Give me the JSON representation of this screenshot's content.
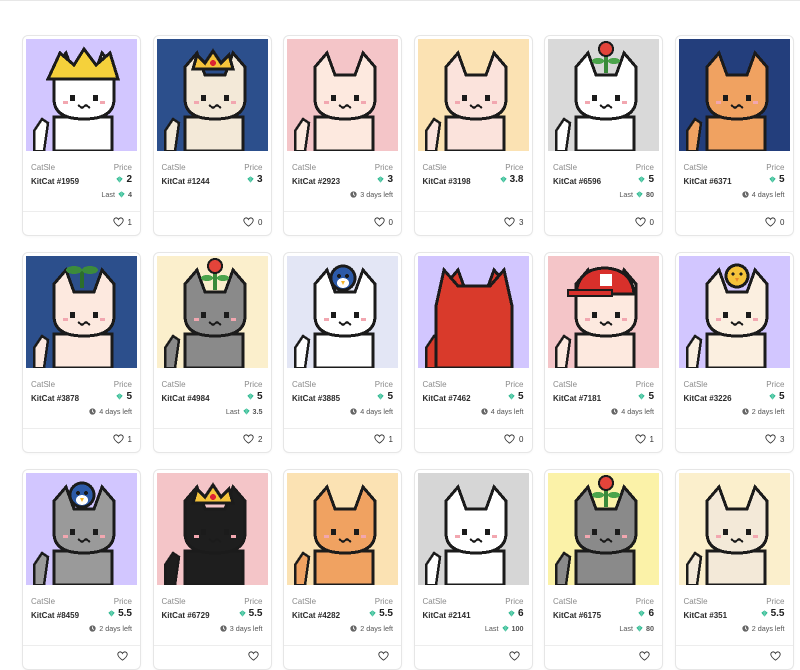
{
  "colors": {
    "gem": "#2fb991",
    "card_border": "#e6e6e6"
  },
  "cards": [
    {
      "collection": "CatSle",
      "name": "KitCat #1959",
      "price_label": "Price",
      "price": "2",
      "sub_type": "last",
      "sub_prefix": "Last",
      "sub_value": "4",
      "likes": "1",
      "bg": "#d2c6ff",
      "coat": "#ffffff",
      "hat": "yellow-hat"
    },
    {
      "collection": "CatSle",
      "name": "KitCat #1244",
      "price_label": "Price",
      "price": "3",
      "sub_type": "none",
      "sub_prefix": "",
      "sub_value": "",
      "likes": "0",
      "bg": "#2c4f8c",
      "coat": "#f3e9d8",
      "hat": "crown"
    },
    {
      "collection": "CatSle",
      "name": "KitCat #2923",
      "price_label": "Price",
      "price": "3",
      "sub_type": "time",
      "sub_prefix": "",
      "sub_value": "3 days left",
      "likes": "0",
      "bg": "#f4c5c8",
      "coat": "#fde9df",
      "hat": "none"
    },
    {
      "collection": "CatSle",
      "name": "KitCat #3198",
      "price_label": "Price",
      "price": "3.8",
      "sub_type": "none",
      "sub_prefix": "",
      "sub_value": "",
      "likes": "3",
      "bg": "#fbe2b3",
      "coat": "#fbe3dc",
      "hat": "none"
    },
    {
      "collection": "CatSle",
      "name": "KitCat #6596",
      "price_label": "Price",
      "price": "5",
      "sub_type": "last",
      "sub_prefix": "Last",
      "sub_value": "80",
      "likes": "0",
      "bg": "#d9d9d9",
      "coat": "#ffffff",
      "hat": "flower"
    },
    {
      "collection": "CatSle",
      "name": "KitCat #6371",
      "price_label": "Price",
      "price": "5",
      "sub_type": "time",
      "sub_prefix": "",
      "sub_value": "4 days left",
      "likes": "0",
      "bg": "#233e7c",
      "coat": "#f0a261",
      "hat": "none"
    },
    {
      "collection": "CatSle",
      "name": "KitCat #3878",
      "price_label": "Price",
      "price": "5",
      "sub_type": "time",
      "sub_prefix": "",
      "sub_value": "4 days left",
      "likes": "1",
      "bg": "#2c4f8c",
      "coat": "#fde9df",
      "hat": "sprout"
    },
    {
      "collection": "CatSle",
      "name": "KitCat #4984",
      "price_label": "Price",
      "price": "5",
      "sub_type": "last",
      "sub_prefix": "Last",
      "sub_value": "3.5",
      "likes": "2",
      "bg": "#fbefcc",
      "coat": "#8a8a8a",
      "hat": "flower"
    },
    {
      "collection": "CatSle",
      "name": "KitCat #3885",
      "price_label": "Price",
      "price": "5",
      "sub_type": "time",
      "sub_prefix": "",
      "sub_value": "4 days left",
      "likes": "1",
      "bg": "#e3e6f5",
      "coat": "#ffffff",
      "hat": "bird"
    },
    {
      "collection": "CatSle",
      "name": "KitCat #7462",
      "price_label": "Price",
      "price": "5",
      "sub_type": "time",
      "sub_prefix": "",
      "sub_value": "4 days left",
      "likes": "0",
      "bg": "#d2c6ff",
      "coat": "#d93a2b",
      "hat": "hood"
    },
    {
      "collection": "CatSle",
      "name": "KitCat #7181",
      "price_label": "Price",
      "price": "5",
      "sub_type": "time",
      "sub_prefix": "",
      "sub_value": "4 days left",
      "likes": "1",
      "bg": "#f4c5c8",
      "coat": "#fde9df",
      "hat": "cap"
    },
    {
      "collection": "CatSle",
      "name": "KitCat #3226",
      "price_label": "Price",
      "price": "5",
      "sub_type": "time",
      "sub_prefix": "",
      "sub_value": "2 days left",
      "likes": "3",
      "bg": "#d2c6ff",
      "coat": "#fbefe0",
      "hat": "chick"
    },
    {
      "collection": "CatSle",
      "name": "KitCat #8459",
      "price_label": "Price",
      "price": "5.5",
      "sub_type": "time",
      "sub_prefix": "",
      "sub_value": "2 days left",
      "likes": "",
      "bg": "#d2c6ff",
      "coat": "#9a9a9a",
      "hat": "bird"
    },
    {
      "collection": "CatSle",
      "name": "KitCat #6729",
      "price_label": "Price",
      "price": "5.5",
      "sub_type": "time",
      "sub_prefix": "",
      "sub_value": "3 days left",
      "likes": "",
      "bg": "#f4c5c8",
      "coat": "#1e1e1e",
      "hat": "crown"
    },
    {
      "collection": "CatSle",
      "name": "KitCat #4282",
      "price_label": "Price",
      "price": "5.5",
      "sub_type": "time",
      "sub_prefix": "",
      "sub_value": "2 days left",
      "likes": "",
      "bg": "#fbe2b3",
      "coat": "#f0a261",
      "hat": "none"
    },
    {
      "collection": "CatSle",
      "name": "KitCat #2141",
      "price_label": "Price",
      "price": "6",
      "sub_type": "last",
      "sub_prefix": "Last",
      "sub_value": "100",
      "likes": "",
      "bg": "#d6d6d6",
      "coat": "#ffffff",
      "hat": "none"
    },
    {
      "collection": "CatSle",
      "name": "KitCat #6175",
      "price_label": "Price",
      "price": "6",
      "sub_type": "last",
      "sub_prefix": "Last",
      "sub_value": "80",
      "likes": "",
      "bg": "#fbf2a8",
      "coat": "#8a8a8a",
      "hat": "flower"
    },
    {
      "collection": "CatSle",
      "name": "KitCat #351",
      "price_label": "Price",
      "price": "5.5",
      "sub_type": "time",
      "sub_prefix": "",
      "sub_value": "2 days left",
      "likes": "",
      "bg": "#fbefcc",
      "coat": "#f3e9d8",
      "hat": "none"
    }
  ]
}
